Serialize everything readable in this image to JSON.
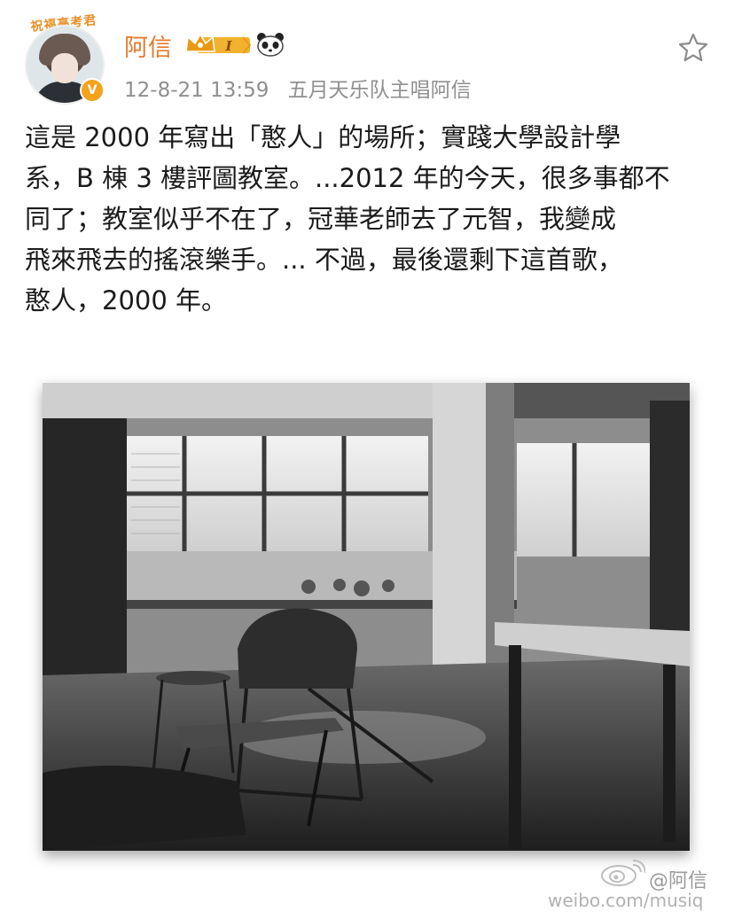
{
  "post": {
    "avatar_banner": "祝福高考君",
    "verified_mark": "V",
    "username": "阿信",
    "level_badge": "I",
    "date": "12-8-21 13:59",
    "source": "五月天乐队主唱阿信",
    "text_lines": [
      "這是 2000 年寫出「憨人」的場所；實踐大學設計學",
      "系，B 棟 3 樓評圖教室。...2012 年的今天，很多事都不",
      "同了；教室似乎不在了，冠華老師去了元智，我變成",
      "飛來飛去的搖滾樂手。... 不過，最後還剩下這首歌，",
      "憨人，2000 年。"
    ]
  },
  "watermark": {
    "handle": "@阿信",
    "url": "weibo.com/musiq"
  },
  "icons": {
    "favorite": "star-outline-icon",
    "crown": "crown-icon",
    "panda": "panda-icon",
    "verified": "verified-badge-icon",
    "weibo_logo": "weibo-eye-logo-icon"
  },
  "colors": {
    "username": "#e8792b",
    "meta": "#8f8f8f",
    "crown_badge": "#f2b12e",
    "verified": "#f4a21a"
  }
}
